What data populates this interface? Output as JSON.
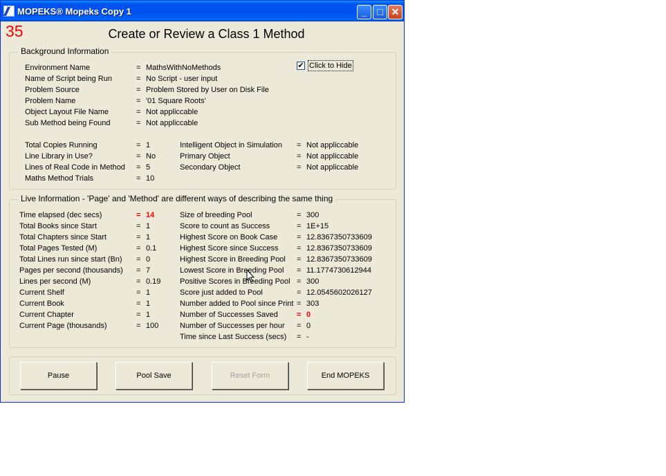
{
  "window": {
    "title": "MOPEKS® Mopeks Copy 1",
    "minimize": "_",
    "maximize": "□",
    "close": "✕"
  },
  "counter": "35",
  "heading": "Create or Review a Class 1 Method",
  "background": {
    "legend": "Background Information",
    "checkbox": {
      "label": "Click to Hide",
      "checked": true,
      "mark": "✔"
    },
    "rows": [
      {
        "label": "Environment Name",
        "eq": "=",
        "value": "MathsWithNoMethods"
      },
      {
        "label": "Name of Script being Run",
        "eq": "=",
        "value": "No Script - user input"
      },
      {
        "label": "Problem Source",
        "eq": "=",
        "value": "Problem Stored by User on Disk File"
      },
      {
        "label": "Problem Name",
        "eq": "=",
        "value": "'01    Square Roots'"
      },
      {
        "label": "Object Layout File Name",
        "eq": "=",
        "value": "Not appliccable"
      },
      {
        "label": "Sub Method being Found",
        "eq": "=",
        "value": "Not appliccable"
      }
    ],
    "rows_left": [
      {
        "label": "Total Copies Running",
        "eq": "=",
        "value": "1"
      },
      {
        "label": "Line Library in Use?",
        "eq": "=",
        "value": "No"
      },
      {
        "label": "Lines of Real Code in Method",
        "eq": "=",
        "value": "5"
      },
      {
        "label": "Maths Method Trials",
        "eq": "=",
        "value": "10"
      }
    ],
    "rows_right": [
      {
        "label": "Intelligent Object in Simulation",
        "eq": "=",
        "value": "Not appliccable"
      },
      {
        "label": "Primary Object",
        "eq": "=",
        "value": "Not appliccable"
      },
      {
        "label": "Secondary Object",
        "eq": "=",
        "value": "Not appliccable"
      }
    ]
  },
  "live": {
    "legend": "Live Information - 'Page' and 'Method' are different ways of describing the same thing",
    "left": [
      {
        "label": "Time elapsed (dec secs)",
        "eq": "=",
        "value": "14",
        "highlight": true
      },
      {
        "label": "Total Books since Start",
        "eq": "=",
        "value": "1"
      },
      {
        "label": "Total Chapters since Start",
        "eq": "=",
        "value": "1"
      },
      {
        "label": "Total Pages Tested (M)",
        "eq": "=",
        "value": "0.1"
      },
      {
        "label": "Total Lines run since start (Bn)",
        "eq": "=",
        "value": "0"
      },
      {
        "label": "Pages per second (thousands)",
        "eq": "=",
        "value": "7"
      },
      {
        "label": "Lines per second (M)",
        "eq": "=",
        "value": "0.19"
      },
      {
        "label": "Current Shelf",
        "eq": "=",
        "value": "1"
      },
      {
        "label": "Current Book",
        "eq": "=",
        "value": "1"
      },
      {
        "label": "Current Chapter",
        "eq": "=",
        "value": "1"
      },
      {
        "label": "Current Page (thousands)",
        "eq": "=",
        "value": "100"
      }
    ],
    "right": [
      {
        "label": "Size of breeding Pool",
        "eq": "=",
        "value": "300"
      },
      {
        "label": "Score to count as Success",
        "eq": "=",
        "value": "1E+15"
      },
      {
        "label": "Highest Score on Book Case",
        "eq": "=",
        "value": "12.8367350733609"
      },
      {
        "label": "Highest Score since Success",
        "eq": "=",
        "value": "12.8367350733609"
      },
      {
        "label": "Highest Score in Breeding Pool",
        "eq": "=",
        "value": "12.8367350733609"
      },
      {
        "label": "Lowest Score in Breeding Pool",
        "eq": "=",
        "value": "11.1774730612944"
      },
      {
        "label": "Positive Scores in Breeding Pool",
        "eq": "=",
        "value": "300"
      },
      {
        "label": "Score just added to Pool",
        "eq": "=",
        "value": "12.0545602026127"
      },
      {
        "label": "Number added to Pool since Print",
        "eq": "=",
        "value": "303"
      },
      {
        "label": "Number of Successes Saved",
        "eq": "=",
        "value": "0",
        "highlight": true
      },
      {
        "label": "Number of Successes per hour",
        "eq": "=",
        "value": "0"
      },
      {
        "label": "Time since Last Success (secs)",
        "eq": "=",
        "value": "-"
      }
    ]
  },
  "buttons": [
    {
      "label": "Pause",
      "enabled": true
    },
    {
      "label": "Pool Save",
      "enabled": true
    },
    {
      "label": "Reset Form",
      "enabled": false
    },
    {
      "label": "End MOPEKS",
      "enabled": true
    }
  ]
}
